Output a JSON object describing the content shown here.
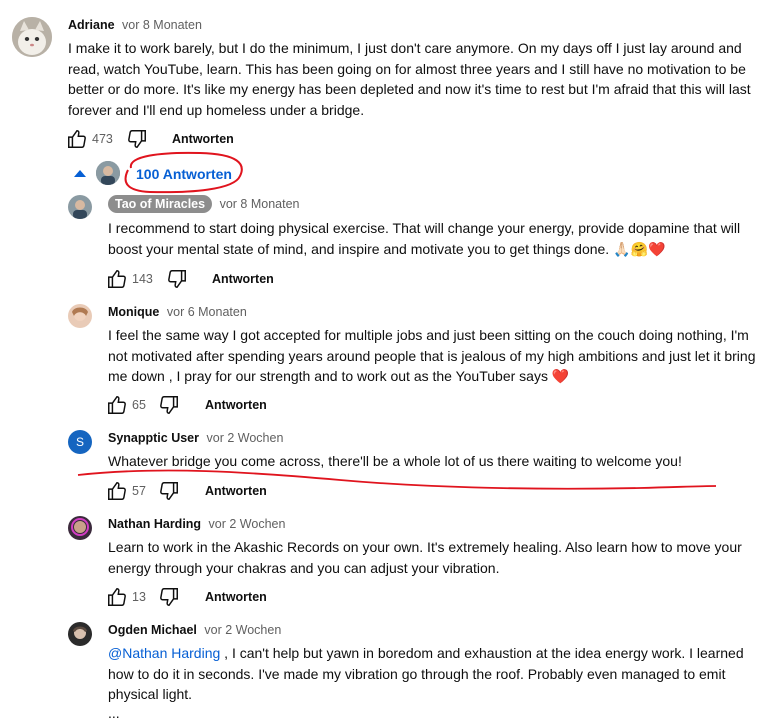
{
  "comments": [
    {
      "author": "Adriane",
      "time": "vor 8 Monaten",
      "text": "I make it to work barely, but I do the minimum, I just don't care anymore. On my days off I just lay around and read, watch YouTube, learn. This has been going on for almost three years and I still have no motivation to be better or do more. It's like my energy has been depleted and now it's time to rest but I'm afraid that this will last forever and I'll end up homeless under a bridge.",
      "likes": "473",
      "reply_label": "Antworten"
    }
  ],
  "replies_toggle": {
    "label": "100 Antworten"
  },
  "replies": [
    {
      "author": "Tao of Miracles",
      "time": "vor 8 Monaten",
      "text": "I recommend to start doing physical exercise. That will change your energy, provide dopamine that will boost your mental state of mind, and inspire and motivate you to get things done. 🙏🏻🤗❤️",
      "likes": "143",
      "reply_label": "Antworten"
    },
    {
      "author": "Monique",
      "time": "vor 6 Monaten",
      "text": "I feel the same way I got accepted for multiple jobs and just been sitting on the couch doing nothing, I'm not motivated after spending years around people that is jealous of my high ambitions and just let it bring me down , I pray for our strength and to work out as the YouTuber says ❤️",
      "likes": "65",
      "reply_label": "Antworten"
    },
    {
      "author": "Synapptic User",
      "avatar_letter": "S",
      "time": "vor 2 Wochen",
      "text": "Whatever bridge you come across, there'll be a whole lot of us there waiting to welcome you!",
      "likes": "57",
      "reply_label": "Antworten"
    },
    {
      "author": "Nathan Harding",
      "time": "vor 2 Wochen",
      "text": "Learn to work in the Akashic Records on your own. It's extremely healing. Also learn how to move your energy through your chakras and you can adjust your vibration.",
      "likes": "13",
      "reply_label": "Antworten"
    },
    {
      "author": "Ogden Michael",
      "time": "vor 2 Wochen",
      "mention": "@Nathan Harding",
      "text": " , I can't help but yawn in boredom and exhaustion at the idea energy work. I learned how to do it in seconds. I've made my vibration go through the roof. Probably even managed to emit physical light.",
      "more": "..."
    }
  ],
  "icons": {
    "like": "thumbs-up-icon",
    "dislike": "thumbs-down-icon",
    "collapse": "triangle-up-icon"
  },
  "colors": {
    "link": "#065fd4",
    "annotation": "#e0141e",
    "muted": "#606060"
  }
}
